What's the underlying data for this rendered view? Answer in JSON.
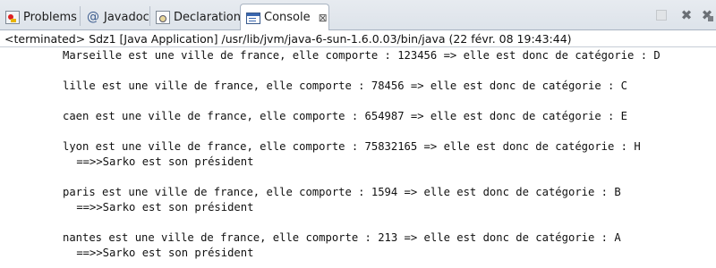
{
  "tabs": [
    {
      "label": "Problems",
      "icon": "problems-icon"
    },
    {
      "label": "Javadoc",
      "icon": "javadoc-icon"
    },
    {
      "label": "Declaration",
      "icon": "declaration-icon"
    },
    {
      "label": "Console",
      "icon": "console-icon",
      "active": true
    }
  ],
  "close_glyph": "⊠",
  "javadoc_glyph": "@",
  "toolbar": {
    "stop_icon": "terminate-icon",
    "remove_launch_icon": "remove-launch-icon",
    "remove_all_icon": "remove-all-terminated-icon",
    "x_glyph": "✖"
  },
  "status": "<terminated> Sdz1 [Java Application] /usr/lib/jvm/java-6-sun-1.6.0.03/bin/java (22 févr. 08 19:43:44)",
  "console_lines": [
    "Marseille est une ville de france, elle comporte : 123456 => elle est donc de catégorie : D",
    "",
    "lille est une ville de france, elle comporte : 78456 => elle est donc de catégorie : C",
    "",
    "caen est une ville de france, elle comporte : 654987 => elle est donc de catégorie : E",
    "",
    "lyon est une ville de france, elle comporte : 75832165 => elle est donc de catégorie : H",
    " ==>>Sarko est son président",
    "",
    "paris est une ville de france, elle comporte : 1594 => elle est donc de catégorie : B",
    " ==>>Sarko est son président",
    "",
    "nantes est une ville de france, elle comporte : 213 => elle est donc de catégorie : A",
    " ==>>Sarko est son président"
  ]
}
